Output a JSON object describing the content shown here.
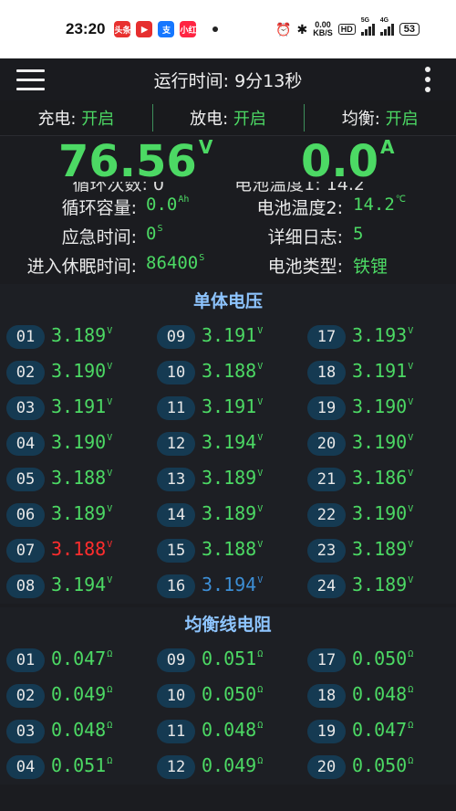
{
  "status_bar": {
    "time": "23:20",
    "speed_value": "0.00",
    "speed_unit": "KB/S",
    "hd": "HD",
    "sig1": "5G",
    "sig2": "4G",
    "battery": "53",
    "apps": [
      {
        "name": "toutiao-icon",
        "label": "头条",
        "color": "#e8312f"
      },
      {
        "name": "video-icon",
        "label": "▶",
        "color": "#e62e2e"
      },
      {
        "name": "alipay-icon",
        "label": "支",
        "color": "#1677ff"
      },
      {
        "name": "shop-icon",
        "label": "小红",
        "color": "#ff2442"
      }
    ]
  },
  "header": {
    "title": "运行时间: 9分13秒"
  },
  "toggles": [
    {
      "label": "充电: ",
      "state": "开启"
    },
    {
      "label": "放电: ",
      "state": "开启"
    },
    {
      "label": "均衡: ",
      "state": "开启"
    }
  ],
  "readings": {
    "voltage": "76.56",
    "voltage_unit": "V",
    "current": "0.0",
    "current_unit": "A"
  },
  "ghost": {
    "left": "循环次数: 0",
    "right": "电池温度1: 14.2"
  },
  "info": [
    {
      "l1": "循环容量: ",
      "v1": "0.0",
      "u1": "Ah",
      "l2": "电池温度2: ",
      "v2": "14.2",
      "u2": "℃"
    },
    {
      "l1": "应急时间: ",
      "v1": "0",
      "u1": "S",
      "l2": "详细日志: ",
      "v2": "5",
      "u2": ""
    },
    {
      "l1": "进入休眠时间: ",
      "v1": "86400",
      "u1": "S",
      "l2": "电池类型: ",
      "v2": "铁锂",
      "u2": ""
    }
  ],
  "cell_voltage": {
    "title": "单体电压",
    "unit": "V",
    "cells": [
      {
        "id": "01",
        "v": "3.189",
        "s": ""
      },
      {
        "id": "09",
        "v": "3.191",
        "s": ""
      },
      {
        "id": "17",
        "v": "3.193",
        "s": ""
      },
      {
        "id": "02",
        "v": "3.190",
        "s": ""
      },
      {
        "id": "10",
        "v": "3.188",
        "s": ""
      },
      {
        "id": "18",
        "v": "3.191",
        "s": ""
      },
      {
        "id": "03",
        "v": "3.191",
        "s": ""
      },
      {
        "id": "11",
        "v": "3.191",
        "s": ""
      },
      {
        "id": "19",
        "v": "3.190",
        "s": ""
      },
      {
        "id": "04",
        "v": "3.190",
        "s": ""
      },
      {
        "id": "12",
        "v": "3.194",
        "s": ""
      },
      {
        "id": "20",
        "v": "3.190",
        "s": ""
      },
      {
        "id": "05",
        "v": "3.188",
        "s": ""
      },
      {
        "id": "13",
        "v": "3.189",
        "s": ""
      },
      {
        "id": "21",
        "v": "3.186",
        "s": ""
      },
      {
        "id": "06",
        "v": "3.189",
        "s": ""
      },
      {
        "id": "14",
        "v": "3.189",
        "s": ""
      },
      {
        "id": "22",
        "v": "3.190",
        "s": ""
      },
      {
        "id": "07",
        "v": "3.188",
        "s": "hi"
      },
      {
        "id": "15",
        "v": "3.188",
        "s": ""
      },
      {
        "id": "23",
        "v": "3.189",
        "s": ""
      },
      {
        "id": "08",
        "v": "3.194",
        "s": ""
      },
      {
        "id": "16",
        "v": "3.194",
        "s": "lo"
      },
      {
        "id": "24",
        "v": "3.189",
        "s": ""
      }
    ]
  },
  "wire_resistance": {
    "title": "均衡线电阻",
    "unit": "Ω",
    "cells": [
      {
        "id": "01",
        "v": "0.047",
        "s": ""
      },
      {
        "id": "09",
        "v": "0.051",
        "s": ""
      },
      {
        "id": "17",
        "v": "0.050",
        "s": ""
      },
      {
        "id": "02",
        "v": "0.049",
        "s": ""
      },
      {
        "id": "10",
        "v": "0.050",
        "s": ""
      },
      {
        "id": "18",
        "v": "0.048",
        "s": ""
      },
      {
        "id": "03",
        "v": "0.048",
        "s": ""
      },
      {
        "id": "11",
        "v": "0.048",
        "s": ""
      },
      {
        "id": "19",
        "v": "0.047",
        "s": ""
      },
      {
        "id": "04",
        "v": "0.051",
        "s": ""
      },
      {
        "id": "12",
        "v": "0.049",
        "s": ""
      },
      {
        "id": "20",
        "v": "0.050",
        "s": ""
      }
    ]
  }
}
